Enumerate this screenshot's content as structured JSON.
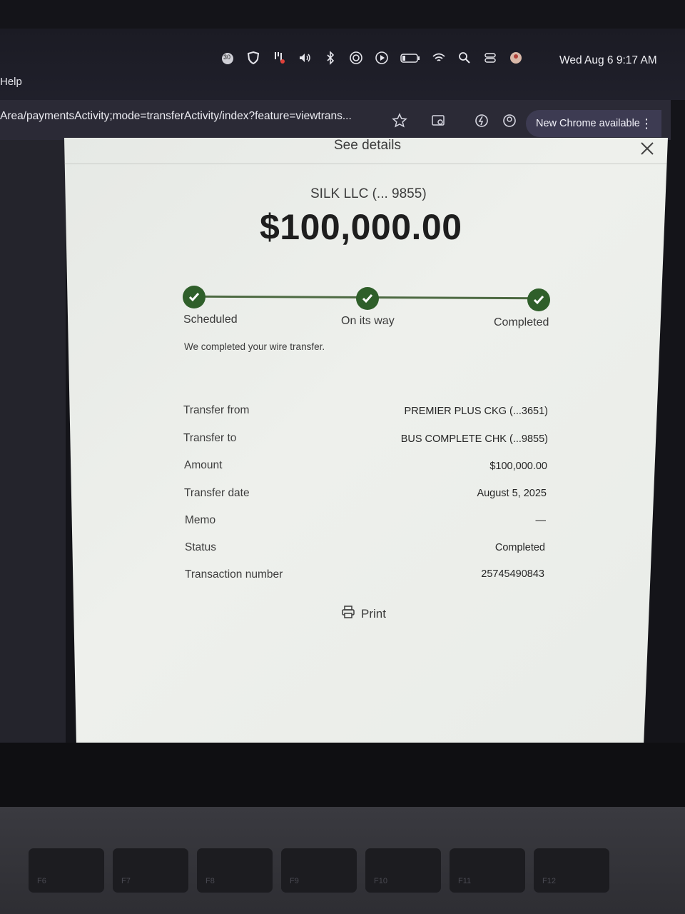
{
  "menubar": {
    "app_menu": "Help",
    "clock": "Wed Aug 6  9:17 AM",
    "timer_badge": "30",
    "icons": [
      "timer-icon",
      "shield-icon",
      "tools-icon",
      "volume-icon",
      "bluetooth-icon",
      "airdrop-icon",
      "play-icon",
      "battery-icon",
      "wifi-icon",
      "search-icon",
      "control-center-icon",
      "avatar-icon"
    ]
  },
  "browser": {
    "url": "Area/paymentsActivity;mode=transferActivity/index?feature=viewtrans...",
    "chrome_badge": "New Chrome available"
  },
  "modal": {
    "title": "See details",
    "payee": "SILK LLC (... 9855)",
    "amount": "$100,000.00",
    "steps": [
      {
        "label": "Scheduled",
        "done": true
      },
      {
        "label": "On its way",
        "done": true
      },
      {
        "label": "Completed",
        "done": true
      }
    ],
    "note": "We completed your wire transfer.",
    "details": [
      {
        "label": "Transfer from",
        "value": "PREMIER PLUS CKG (...3651)"
      },
      {
        "label": "Transfer to",
        "value": "BUS COMPLETE CHK (...9855)"
      },
      {
        "label": "Amount",
        "value": "$100,000.00"
      },
      {
        "label": "Transfer date",
        "value": "August 5, 2025"
      },
      {
        "label": "Memo",
        "value": "—"
      },
      {
        "label": "Status",
        "value": "Completed"
      },
      {
        "label": "Transaction number",
        "value": "25745490843"
      }
    ],
    "print_label": "Print"
  },
  "keyboard": {
    "keys": [
      "F6",
      "F7",
      "F8",
      "F9",
      "F10",
      "F11",
      "F12"
    ]
  },
  "colors": {
    "step_green": "#2f5f2a",
    "track_green": "#4d6a42",
    "chrome_badge_bg": "#3d3b52"
  }
}
